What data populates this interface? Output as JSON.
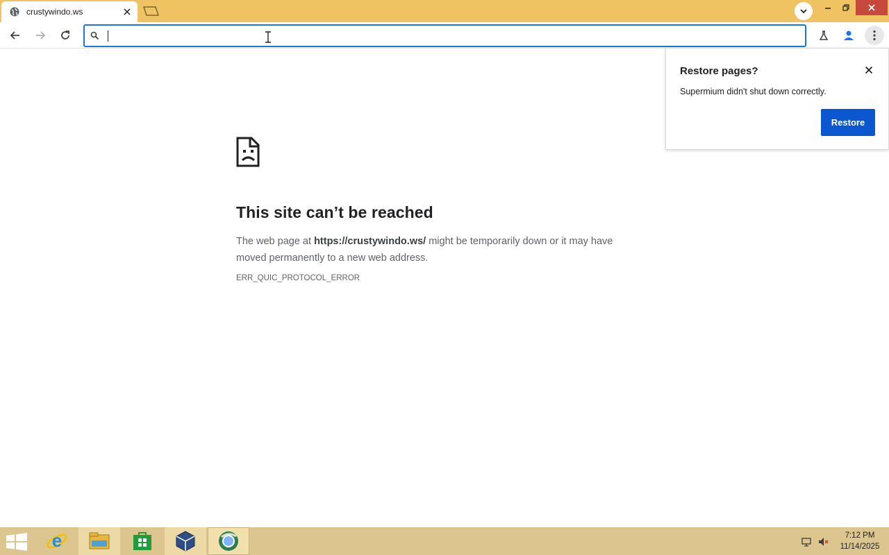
{
  "window": {
    "tab_title": "crustywindo.ws",
    "accent_color": "#efc262"
  },
  "toolbar": {
    "omnibox_value": "",
    "omnibox_focus_color": "#1a73e8"
  },
  "error_page": {
    "title": "This site can’t be reached",
    "desc_prefix": "The web page at ",
    "desc_url": "https://crustywindo.ws/",
    "desc_suffix": " might be temporarily down or it may have moved permanently to a new web address.",
    "error_code": "ERR_QUIC_PROTOCOL_ERROR"
  },
  "restore_bubble": {
    "title": "Restore pages?",
    "message": "Supermium didn't shut down correctly.",
    "button_label": "Restore",
    "button_color": "#0b57d0"
  },
  "taskbar": {
    "color": "#dcc58f",
    "items": [
      "start-icon",
      "ie-icon",
      "file-explorer-icon",
      "store-icon",
      "virtualbox-icon",
      "supermium-icon"
    ],
    "clock_time": "7:12 PM",
    "clock_date": "11/14/2025"
  }
}
